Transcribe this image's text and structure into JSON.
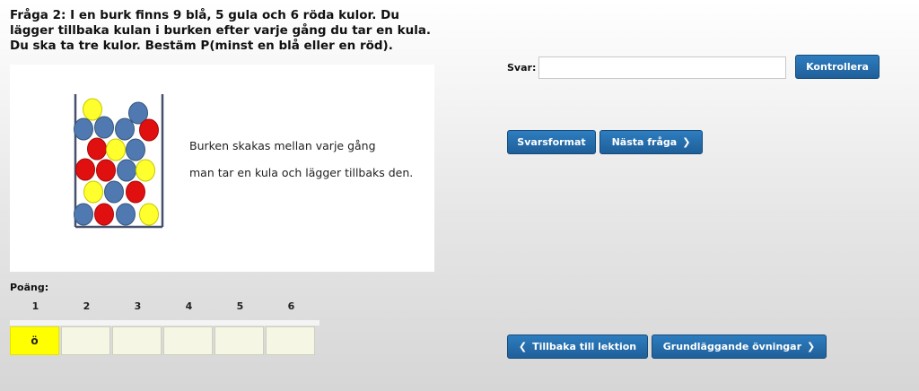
{
  "question": {
    "line1": "Fråga 2: I en burk finns 9 blå, 5 gula och 6 röda kulor. Du",
    "line2": "lägger tillbaka kulan i burken efter varje gång du tar en kula.",
    "line3": "Du ska ta tre kulor. Bestäm P(minst en blå eller en röd)."
  },
  "panel": {
    "text_line1": "Burken skakas mellan varje gång",
    "text_line2": "man tar en kula och lägger tillbaks den.",
    "colors": {
      "blue": "#4f79b0",
      "yellow": "#ffff2e",
      "red": "#e01010"
    }
  },
  "score": {
    "label": "Poäng:",
    "columns": [
      "1",
      "2",
      "3",
      "4",
      "5",
      "6"
    ],
    "cells": [
      "ö",
      "",
      "",
      "",
      "",
      ""
    ],
    "active_color": "#ffff00"
  },
  "answer": {
    "label": "Svar:",
    "value": "",
    "placeholder": "",
    "check_button": "Kontrollera"
  },
  "actions": {
    "format_button": "Svarsformat",
    "next_button": "Nästa fråga",
    "back_button": "Tillbaka till lektion",
    "basic_button": "Grundläggande övningar"
  },
  "icons": {
    "chevron_right": "chevron-right-icon",
    "chevron_left": "chevron-left-icon"
  },
  "accent": "#2a6fad"
}
